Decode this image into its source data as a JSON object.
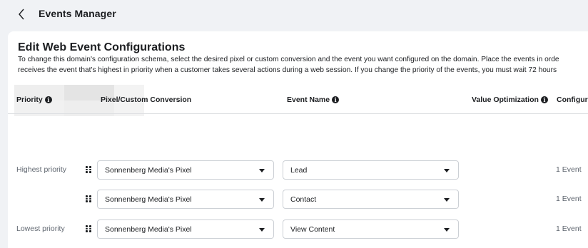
{
  "header": {
    "title": "Events Manager"
  },
  "card": {
    "title": "Edit Web Event Configurations",
    "description_line1": "To change this domain's configuration schema, select the desired pixel or custom conversion and the event you want configured on the domain. Place the events in orde",
    "description_line2": "receives the event that's highest in priority when a customer takes several actions during a web session. If you change the priority of the events, you must wait 72 hours"
  },
  "table": {
    "headers": {
      "priority": "Priority",
      "pixel": "Pixel/Custom Conversion",
      "event": "Event Name",
      "value_opt": "Value Optimization",
      "configured": "Configur"
    },
    "rows": [
      {
        "priority_label": "Highest priority",
        "pixel": "Sonnenberg Media's Pixel",
        "event": "Lead",
        "count": "1 Event"
      },
      {
        "priority_label": "",
        "pixel": "Sonnenberg Media's Pixel",
        "event": "Contact",
        "count": "1 Event"
      },
      {
        "priority_label": "Lowest priority",
        "pixel": "Sonnenberg Media's Pixel",
        "event": "View Content",
        "count": "1 Event"
      }
    ]
  },
  "icons": {
    "back": "chevron-left-icon",
    "info": "info-icon",
    "drag": "drag-handle-icon",
    "dropdown": "caret-down-icon"
  }
}
